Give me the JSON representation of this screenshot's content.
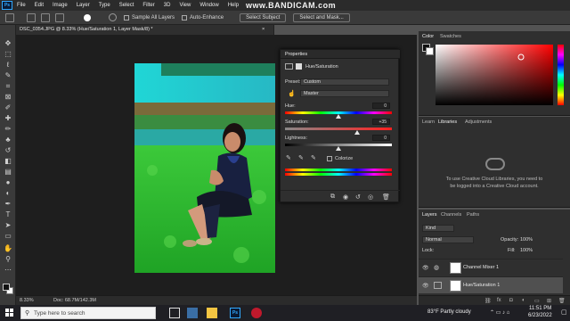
{
  "watermark": "www.BANDICAM.com",
  "menu": [
    "File",
    "Edit",
    "Image",
    "Layer",
    "Type",
    "Select",
    "Filter",
    "3D",
    "View",
    "Window",
    "Help"
  ],
  "options_bar": {
    "sample_all_layers": "Sample All Layers",
    "auto_enhance": "Auto-Enhance",
    "select_subject": "Select Subject",
    "select_and_mask": "Select and Mask..."
  },
  "document": {
    "tab_title": "DSC_0354.JPG @ 8.33% (Hue/Saturation 1, Layer Mask/8) *",
    "close": "×",
    "zoom": "8.33%",
    "doc_info": "Doc: 68.7M/142.3M"
  },
  "properties": {
    "panel_title": "Properties",
    "adjustment": "Hue/Saturation",
    "preset_label": "Preset:",
    "preset_value": "Custom",
    "channel_value": "Master",
    "hue_label": "Hue:",
    "hue_value": "0",
    "hue_level": 0.5,
    "saturation_label": "Saturation:",
    "saturation_value": "+35",
    "saturation_level": 0.675,
    "lightness_label": "Lightness:",
    "lightness_value": "0",
    "lightness_level": 0.5,
    "colorize_label": "Colorize"
  },
  "color_panel": {
    "tabs": [
      "Color",
      "Swatches"
    ],
    "accent": "#ff1a1a"
  },
  "libraries_panel": {
    "tabs": [
      "Learn",
      "Libraries",
      "Adjustments"
    ],
    "message": "To use Creative Cloud Libraries, you need to be logged into a Creative Cloud account."
  },
  "layers_panel": {
    "tabs": [
      "Layers",
      "Channels",
      "Paths"
    ],
    "kind_label": "Kind",
    "blend_mode": "Normal",
    "opacity_label": "Opacity:",
    "opacity_value": "100%",
    "lock_label": "Lock:",
    "fill_label": "Fill:",
    "fill_value": "100%",
    "layers": [
      {
        "name": "Channel Mixer 1",
        "selected": false
      },
      {
        "name": "Hue/Saturation 1",
        "selected": true
      }
    ]
  },
  "taskbar": {
    "search_placeholder": "Type here to search",
    "weather": "83°F  Partly cloudy",
    "time": "11:51 PM",
    "date": "6/23/2022"
  }
}
